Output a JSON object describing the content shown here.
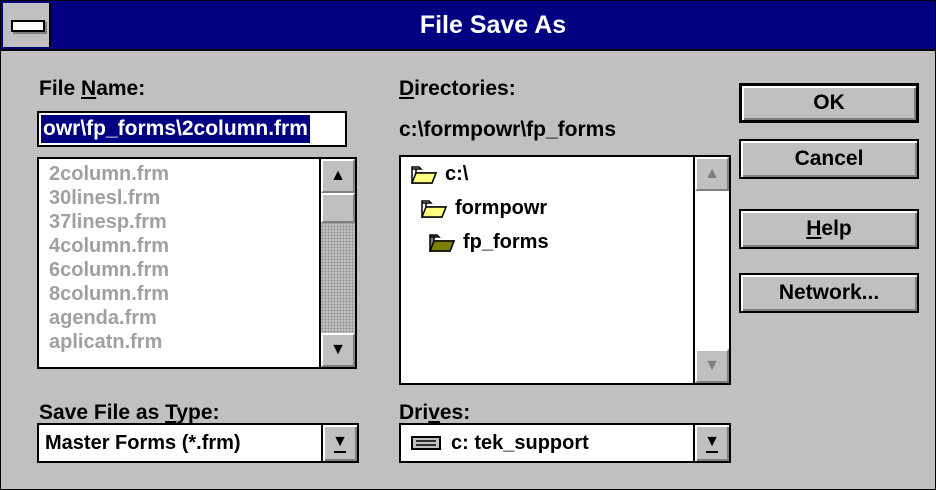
{
  "window": {
    "title": "File Save As"
  },
  "file_name": {
    "label_pre": "File ",
    "label_acc": "N",
    "label_post": "ame:",
    "value": "owr\\fp_forms\\2column.frm",
    "files": [
      "2column.frm",
      "30linesl.frm",
      "37linesp.frm",
      "4column.frm",
      "6column.frm",
      "8column.frm",
      "agenda.frm",
      "aplicatn.frm"
    ]
  },
  "directories": {
    "label_acc": "D",
    "label_post": "irectories:",
    "current_path": "c:\\formpowr\\fp_forms",
    "items": [
      "c:\\",
      "formpowr",
      "fp_forms"
    ]
  },
  "buttons": {
    "ok": "OK",
    "cancel": "Cancel",
    "help_acc": "H",
    "help_post": "elp",
    "network": "Network..."
  },
  "save_type": {
    "label_pre": "Save File as ",
    "label_acc": "T",
    "label_post": "ype:",
    "value": "Master Forms (*.frm)"
  },
  "drives": {
    "label_pre": "Dri",
    "label_acc": "v",
    "label_post": "es:",
    "value": "c: tek_support"
  },
  "icons": [
    "system-menu-icon",
    "folder-open-icon",
    "drive-icon",
    "scroll-up-arrow-icon",
    "scroll-down-arrow-icon",
    "dropdown-arrow-icon"
  ],
  "colors": {
    "titlebar": "#000080",
    "selection": "#000080",
    "face": "#c0c0c0",
    "disabled_text": "#a0a0a0"
  }
}
